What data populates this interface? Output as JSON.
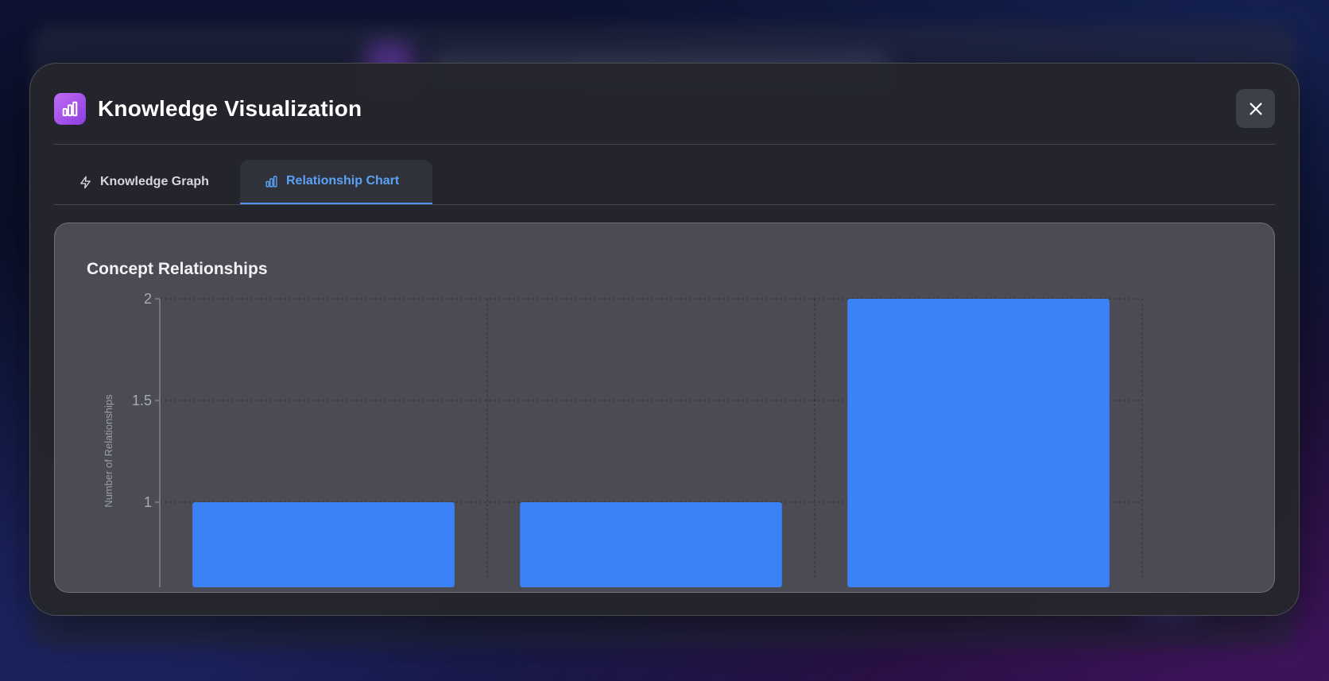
{
  "modal": {
    "title": "Knowledge Visualization",
    "header_icon": "bar-chart-icon",
    "close_icon": "close-icon"
  },
  "tabs": [
    {
      "label": "Knowledge Graph",
      "icon": "lightning-icon",
      "active": false
    },
    {
      "label": "Relationship Chart",
      "icon": "bar-chart-icon",
      "active": true
    }
  ],
  "colors": {
    "accent": "#4e97f0",
    "bar": "#3b82f6",
    "header_icon_gradient": [
      "#c06bf2",
      "#8b3ee0"
    ],
    "panel": "#4a4b55"
  },
  "chart_data": {
    "type": "bar",
    "title": "Concept Relationships",
    "xlabel": "",
    "ylabel": "Number of Relationships",
    "categories": [
      "",
      "",
      ""
    ],
    "values": [
      1,
      1,
      2
    ],
    "yticks": [
      "2",
      "1.5",
      "1"
    ],
    "ylim_visible": [
      0.66,
      2
    ],
    "grid": true
  }
}
